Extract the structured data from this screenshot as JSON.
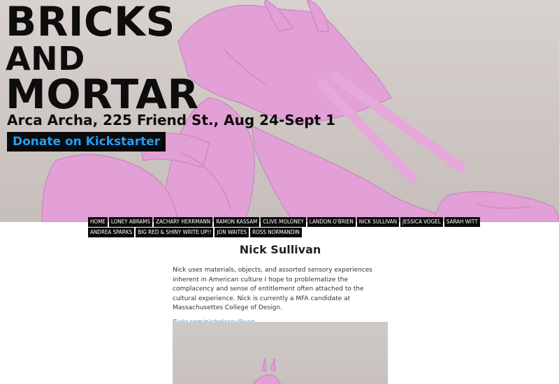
{
  "hero": {
    "title_line1": "BRICKS",
    "title_line2": "AND",
    "title_line3": "MORTAR",
    "event": "Arca Archa, 225 Friend St., Aug 24-Sept 1",
    "donate_label": "Donate on Kickstarter",
    "donate_color": "#1ea0ff"
  },
  "nav": {
    "row1": [
      "HOME",
      "LONEY ABRAMS",
      "ZACHARY HERRMANN",
      "RAMON KASSAM",
      "CLIVE MOLONEY",
      "LANDON O'BRIEN",
      "NICK SULLIVAN",
      "JESSICA VOGEL",
      "SARAH WITT"
    ],
    "row2": [
      "ANDREA SPARKS",
      "BIG RED & SHINY WRITE UP!!",
      "JON WAITES",
      "ROSS NORMANDIN"
    ]
  },
  "main": {
    "title": "Nick Sullivan",
    "bio": "Nick uses materials, objects, and assorted sensory experiences inherent in American culture I hope to problematize the complacency and sense of entitlement often attached to the cultural experience. Nick is currently a MFA candidate at Massachusettes College of Design.",
    "link": "flickr.com/nicholassullivan",
    "link_color": "#2a8fd6"
  },
  "colors": {
    "sculpture_pink": "#e7a0d9",
    "nav_bg": "#0a0a0a"
  }
}
